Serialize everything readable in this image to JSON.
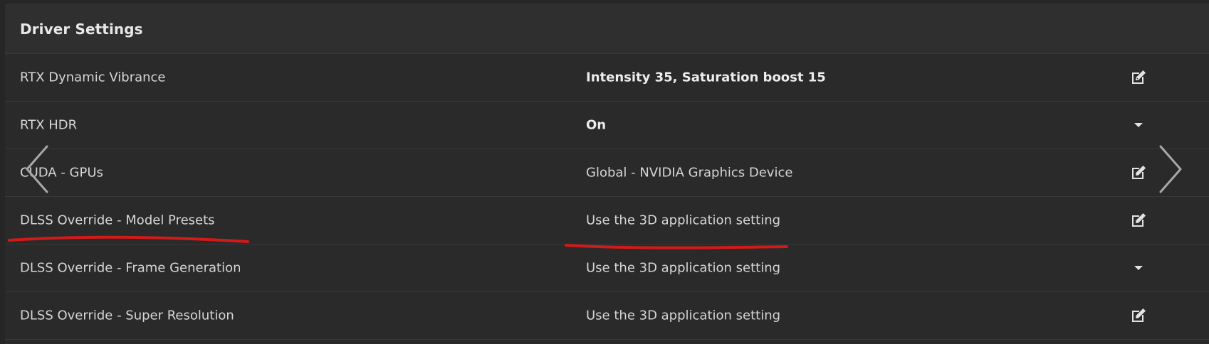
{
  "panel": {
    "title": "Driver Settings"
  },
  "rows": [
    {
      "label": "RTX Dynamic Vibrance",
      "value": "Intensity 35, Saturation boost 15",
      "value_bold": true,
      "action_icon": "edit-icon"
    },
    {
      "label": "RTX HDR",
      "value": "On",
      "value_bold": true,
      "action_icon": "dropdown-caret-icon"
    },
    {
      "label": "CUDA - GPUs",
      "value": "Global - NVIDIA Graphics Device",
      "value_bold": false,
      "action_icon": "edit-icon"
    },
    {
      "label": "DLSS Override - Model Presets",
      "value": "Use the 3D application setting",
      "value_bold": false,
      "action_icon": "edit-icon"
    },
    {
      "label": "DLSS Override - Frame Generation",
      "value": "Use the 3D application setting",
      "value_bold": false,
      "action_icon": "dropdown-caret-icon"
    },
    {
      "label": "DLSS Override - Super Resolution",
      "value": "Use the 3D application setting",
      "value_bold": false,
      "action_icon": "edit-icon"
    }
  ],
  "navigation": {
    "prev_icon": "chevron-left-icon",
    "next_icon": "chevron-right-icon"
  },
  "colors": {
    "background": "#2a2a2a",
    "header_background": "#2f2f2f",
    "text": "#d6d6d6",
    "annotation": "#d11a1a"
  }
}
